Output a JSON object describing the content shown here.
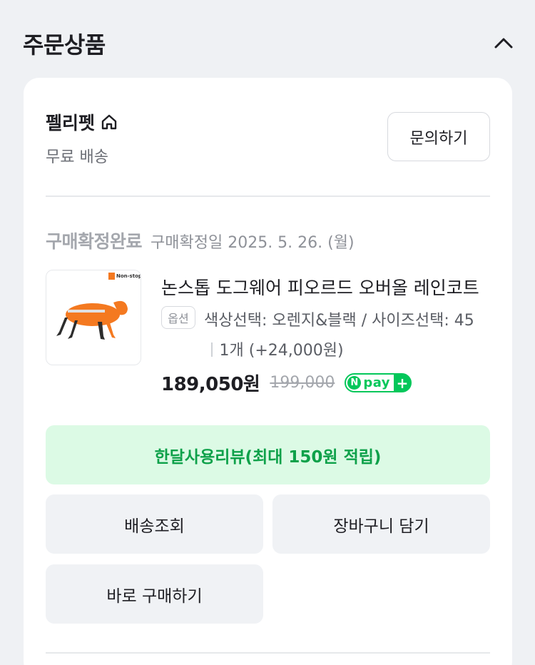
{
  "section": {
    "title": "주문상품",
    "collapse_icon": "chevron-up-icon"
  },
  "seller": {
    "name": "펠리펫",
    "home_icon": "home-icon",
    "shipping": "무료 배송",
    "inquiry_label": "문의하기"
  },
  "order": {
    "status": "구매확정완료",
    "confirm_date": "구매확정일 2025. 5. 26. (월)"
  },
  "product": {
    "name": "논스톱 도그웨어 피오르드 오버올 레인코트",
    "thumbnail_brand": "Non-stop dogwear",
    "option_badge": "옵션",
    "option_text": "색상선택: 오렌지&블랙 / 사이즈선택: 45",
    "quantity": "1개 (+24,000원)",
    "price": "189,050원",
    "original_price": "199,000",
    "npay_n": "N",
    "npay_label": "pay",
    "npay_plus": "+"
  },
  "actions": {
    "review_label": "한달사용리뷰(최대 150원 적립)",
    "track_label": "배송조회",
    "cart_label": "장바구니 담기",
    "buy_label": "바로 구매하기"
  },
  "colors": {
    "accent_green": "#03c75a",
    "review_bg": "#dcfae5",
    "review_text": "#0ea14a",
    "page_bg": "#eff1f4"
  }
}
